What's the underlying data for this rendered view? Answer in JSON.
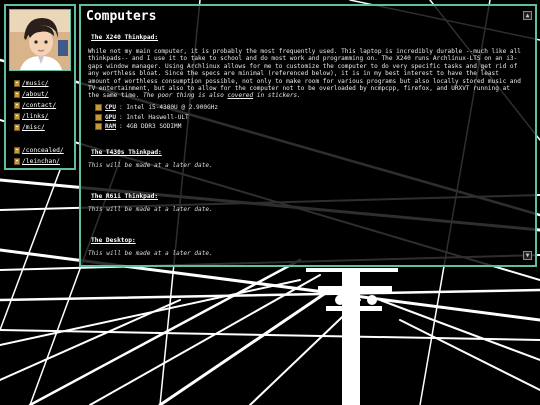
{
  "page": {
    "title": "Computers"
  },
  "sidebar": {
    "links": [
      {
        "label": "/music/"
      },
      {
        "label": "/about/"
      },
      {
        "label": "/contact/"
      },
      {
        "label": "/links/"
      },
      {
        "label": "/misc/"
      },
      {
        "label": "/concealed/"
      },
      {
        "label": "/leinchan/"
      }
    ]
  },
  "sections": [
    {
      "heading": "The X240 Thinkpad:",
      "body_before": "While not my main computer, it is probably the most frequently used. This laptop is incredibly durable --much like all thinkpads-- and I use it to take to school and do most work and programming on. The X240 runs Archlinux-LTS on an i3-gaps window manager. Using Archlinux allows for me to customize the computer to do very specific tasks and get rid of any worthless bloat. Since the specs are minimal (referenced below), it is in my best interest to have the least amount of worthless consumption possible, not only to make room for various programs but also locally stored music and TV entertainment, but also to allow for the computer not to be overloaded by ncmpcpp, firefox, and URXVT running at the same time.",
      "body_italic": "The poor thing is also",
      "body_link": "covered",
      "body_italic_end": "in stickers.",
      "specs": [
        {
          "label": "CPU",
          "value": ": Intel i5-4300U @ 2.900GHz"
        },
        {
          "label": "GPU",
          "value": ": Intel Haswell-ULT"
        },
        {
          "label": "RAM",
          "value": ": 4GB DDR3 SODIMM"
        }
      ]
    },
    {
      "heading": "The T430s Thinkpad:",
      "note": "This will be made at a later date."
    },
    {
      "heading": "The R61i Thinkpad:",
      "note": "This will be made at a later date."
    },
    {
      "heading": "The Desktop:",
      "note": "This will be made at a later date."
    }
  ],
  "scrollbar": {
    "up_icon": "triangle-up-icon",
    "down_icon": "triangle-down-icon"
  },
  "colors": {
    "accent": "#5fbf9f",
    "background": "#000000",
    "text": "#ffffff"
  }
}
